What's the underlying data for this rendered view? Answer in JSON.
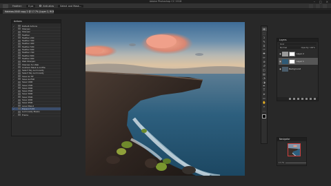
{
  "window": {
    "title": "Adobe Photoshop CC 2018"
  },
  "options_bar": {
    "feather_label": "Feather:",
    "feather_value": "0 px",
    "antialias_label": "Anti-alias",
    "select_mask_label": "Select and Mask..."
  },
  "document_tab": {
    "label": "Haleiwa-0040 copy 2 @ 17.7% (Layer 2, RGB/16*) *"
  },
  "left_panel": {
    "title": "Actions",
    "rows": [
      {
        "label": "Default Actions",
        "selected": false
      },
      {
        "label": "Sharpen",
        "selected": false
      },
      {
        "label": "Sharpen",
        "selected": false
      },
      {
        "label": "Feather",
        "selected": false
      },
      {
        "label": "Feather 200",
        "selected": false
      },
      {
        "label": "Feather 300",
        "selected": false
      },
      {
        "label": "Feather 400",
        "selected": false
      },
      {
        "label": "Feather 500",
        "selected": false
      },
      {
        "label": "Feather 600",
        "selected": false
      },
      {
        "label": "Feather 700",
        "selected": false
      },
      {
        "label": "Feather 800",
        "selected": false
      },
      {
        "label": "Feather 900",
        "selected": false
      },
      {
        "label": "Web Sharpen",
        "selected": false
      },
      {
        "label": "Sharpen for Web",
        "selected": false
      },
      {
        "label": "Unsharp Mask & profile",
        "selected": false
      },
      {
        "label": "Select Sky Luminosity",
        "selected": false
      },
      {
        "label": "Select Sky Luminosity",
        "selected": false
      },
      {
        "label": "Save As TIF",
        "selected": false
      },
      {
        "label": "Save As PSD",
        "selected": false
      },
      {
        "label": "Save 1000",
        "selected": false
      },
      {
        "label": "Save 1500",
        "selected": false
      },
      {
        "label": "Save 2000",
        "selected": false
      },
      {
        "label": "Save 2500",
        "selected": false
      },
      {
        "label": "Save 3000",
        "selected": false
      },
      {
        "label": "Save 3500",
        "selected": false
      },
      {
        "label": "Save 4000",
        "selected": false
      },
      {
        "label": "Save 4500",
        "selected": false
      },
      {
        "label": "Layer Blend",
        "selected": false
      },
      {
        "label": "Expand 5 PX",
        "selected": true
      },
      {
        "label": "Luminosity Masks",
        "selected": false
      },
      {
        "label": "Frame",
        "selected": false
      }
    ]
  },
  "toolbar": {
    "tools": [
      "move-tool",
      "marquee-tool",
      "lasso-tool",
      "quick-select-tool",
      "crop-tool",
      "eyedropper-tool",
      "healing-tool",
      "brush-tool",
      "clone-stamp-tool",
      "history-brush-tool",
      "eraser-tool",
      "gradient-tool",
      "blur-tool",
      "dodge-tool",
      "pen-tool",
      "type-tool",
      "path-select-tool",
      "shape-tool",
      "hand-tool",
      "zoom-tool",
      "more-tools"
    ],
    "glyphs": [
      "✥",
      "⬚",
      "ↄ",
      "✎",
      "⌗",
      "✑",
      "✚",
      "✏",
      "⊛",
      "↺",
      "◫",
      "▤",
      "◔",
      "◑",
      "✒",
      "T",
      "➤",
      "▭",
      "✋",
      "⌕",
      "…"
    ]
  },
  "layers_panel": {
    "title": "Layers",
    "kind_label": "Kind",
    "blend_label": "Normal",
    "opacity_label": "Opacity: 100%",
    "layers": [
      {
        "name": "Layer 2",
        "selected": false,
        "has_mask": true
      },
      {
        "name": "Layer 1",
        "selected": true,
        "has_mask": true
      },
      {
        "name": "Background",
        "selected": false,
        "has_mask": false
      }
    ]
  },
  "navigator_panel": {
    "title": "Navigator",
    "zoom": "17.7%"
  },
  "colors": {
    "app_bg": "#282828",
    "panel_bg": "#2b2b2b",
    "selected_row": "#3b4d6b"
  }
}
